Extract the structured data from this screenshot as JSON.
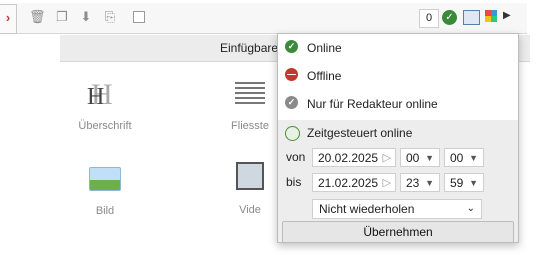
{
  "toolbar": {
    "count": "0",
    "icons": [
      "trash-icon",
      "copy-icon",
      "download-icon",
      "paste-icon",
      "checkbox-icon",
      "status-online-icon",
      "monitor-icon",
      "grid-icon",
      "arrow-right-icon"
    ]
  },
  "panel": {
    "title": "Einfügbare",
    "items": [
      {
        "label": "Überschrift"
      },
      {
        "label": "Fliesste"
      },
      {
        "label": "Bild"
      },
      {
        "label": "Vide"
      }
    ]
  },
  "status_menu": {
    "options": [
      {
        "label": "Online",
        "color": "#3a8a3a"
      },
      {
        "label": "Offline",
        "color": "#c0392b"
      },
      {
        "label": "Nur für Redakteur online",
        "color": "#8a8a8a"
      }
    ],
    "scheduled": {
      "title": "Zeitgesteuert online",
      "from_label": "von",
      "from_date": "20.02.2025",
      "from_hour": "00",
      "from_min": "00",
      "to_label": "bis",
      "to_date": "21.02.2025",
      "to_hour": "23",
      "to_min": "59",
      "repeat": "Nicht wiederholen",
      "apply_label": "Übernehmen"
    }
  }
}
